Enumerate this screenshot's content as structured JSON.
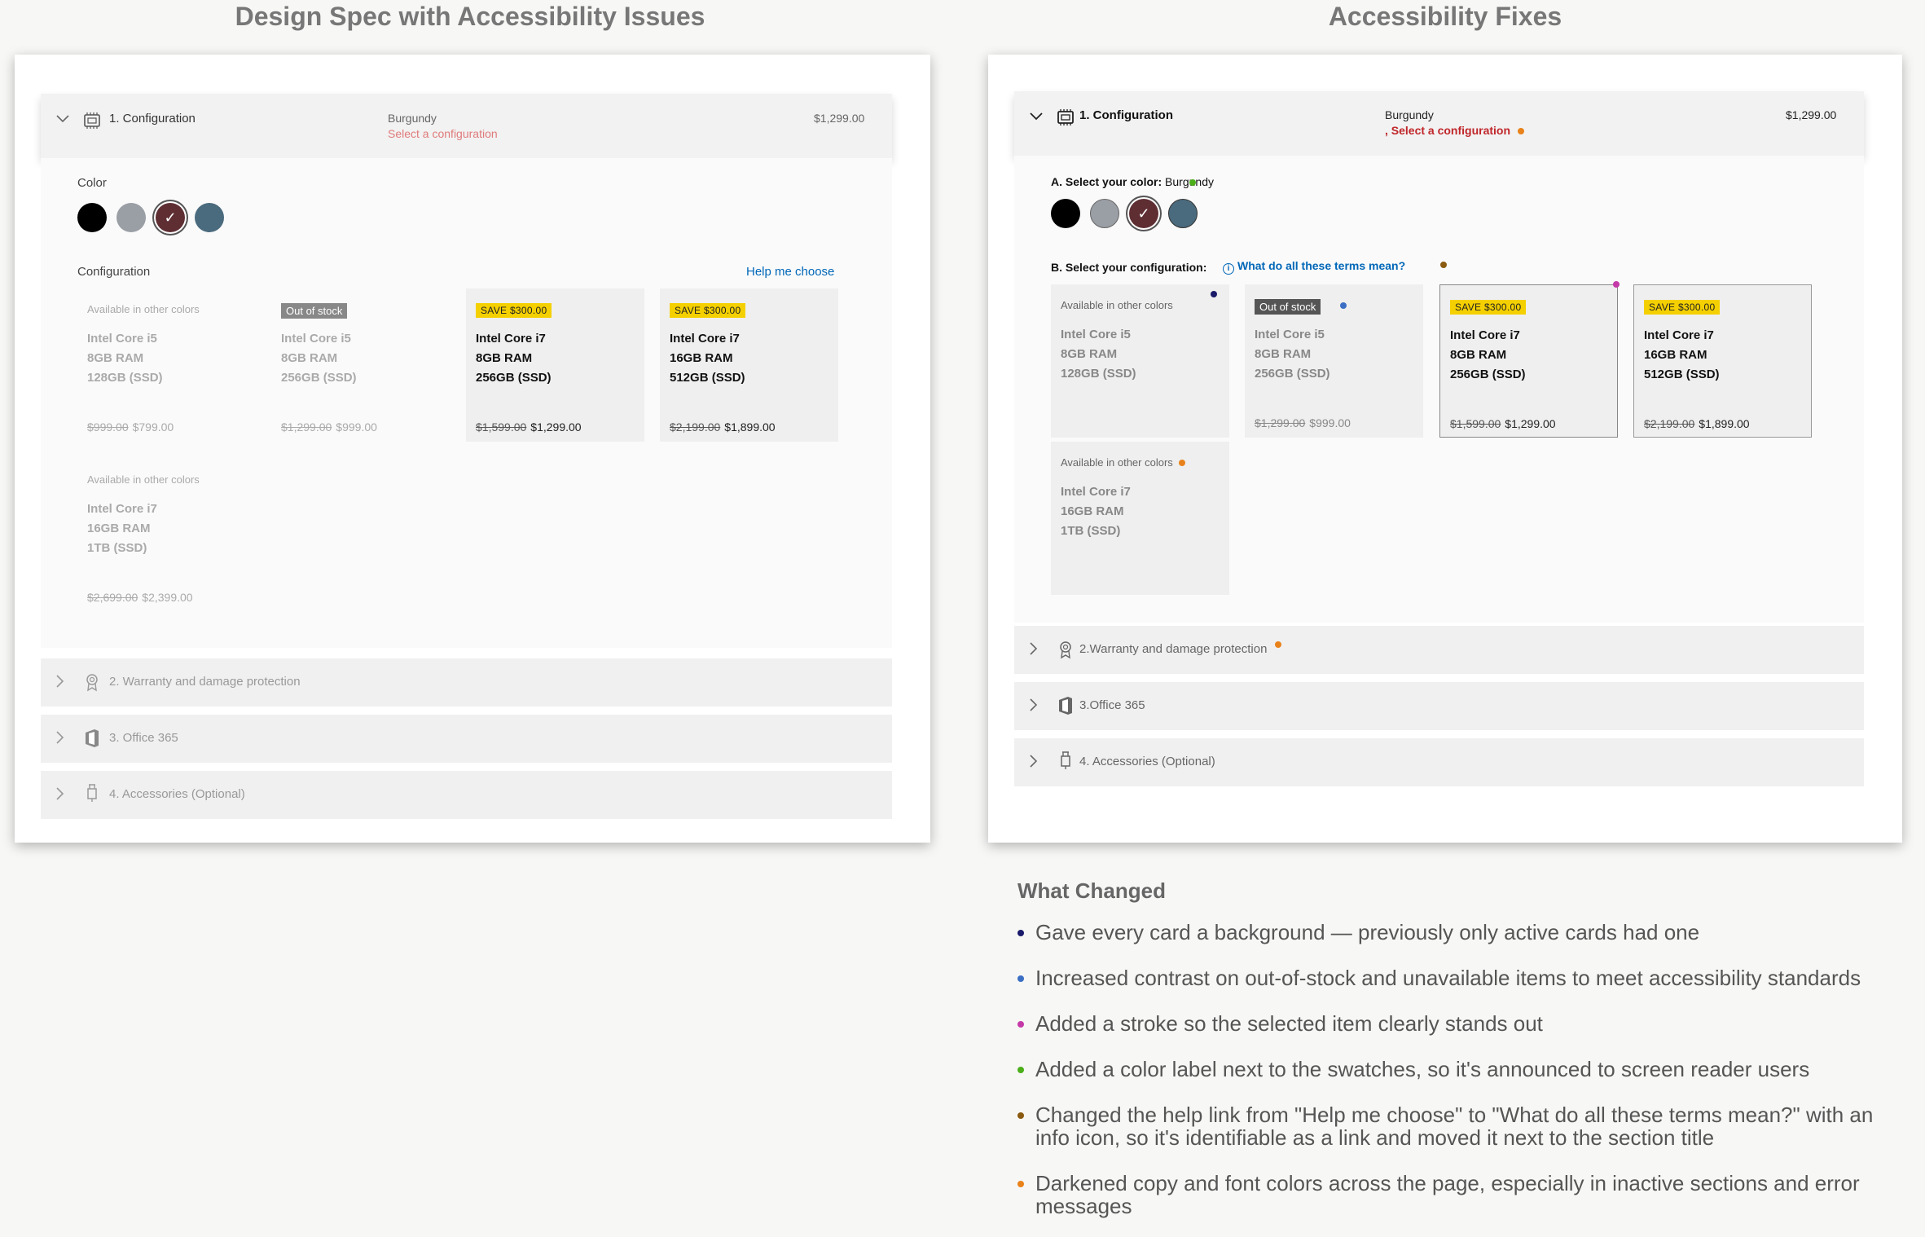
{
  "left_title": "Design Spec with Accessibility Issues",
  "right_title": "Accessibility Fixes",
  "colors": {
    "navy": "#1a1a6b",
    "blue": "#3a6fc4",
    "magenta": "#c43aa8",
    "green": "#4caf1a",
    "brown": "#8a5a10",
    "orange": "#e8821a",
    "sale_yellow": "#f5d000",
    "link_blue": "#0067b8",
    "swatch_black": "#000000",
    "swatch_gray": "#9a9ea5",
    "swatch_burgundy": "#5e2e33",
    "swatch_teal": "#4a6a7d"
  },
  "left": {
    "config_title": "1. Configuration",
    "color_name": "Burgundy",
    "error": "Select a configuration",
    "price": "$1,299.00",
    "color_label": "Color",
    "config_label": "Configuration",
    "help_link": "Help me choose",
    "cards": [
      {
        "tag": "Available in other colors",
        "line1": "Intel Core i5",
        "line2": "8GB RAM",
        "line3": "128GB (SSD)",
        "old": "$999.00",
        "new": "$799.00"
      },
      {
        "tag": "Out of stock",
        "line1": "Intel Core i5",
        "line2": "8GB RAM",
        "line3": "256GB (SSD)",
        "old": "$1,299.00",
        "new": "$999.00"
      },
      {
        "tag": "SAVE $300.00",
        "line1": "Intel Core i7",
        "line2": "8GB RAM",
        "line3": "256GB (SSD)",
        "old": "$1,599.00",
        "new": "$1,299.00"
      },
      {
        "tag": "SAVE $300.00",
        "line1": "Intel Core i7",
        "line2": "16GB RAM",
        "line3": "512GB (SSD)",
        "old": "$2,199.00",
        "new": "$1,899.00"
      },
      {
        "tag": "Available in other colors",
        "line1": "Intel Core i7",
        "line2": "16GB RAM",
        "line3": "1TB (SSD)",
        "old": "$2,699.00",
        "new": "$2,399.00"
      }
    ],
    "warranty": "2. Warranty and damage protection",
    "office": "3. Office 365",
    "accessories": "4. Accessories (Optional)"
  },
  "right": {
    "config_title": "1. Configuration",
    "color_name": "Burgundy",
    "error_prefix": ",",
    "error": "Select a configuration",
    "price": "$1,299.00",
    "color_label": "A. Select your color:",
    "color_value": "Burgundy",
    "config_label": "B. Select your configuration:",
    "help_link": "What do all these terms mean?",
    "cards": [
      {
        "tag": "Available in other colors",
        "line1": "Intel Core i5",
        "line2": "8GB RAM",
        "line3": "128GB (SSD)",
        "old": "",
        "new": ""
      },
      {
        "tag": "Out of stock",
        "line1": "Intel Core i5",
        "line2": "8GB RAM",
        "line3": "256GB (SSD)",
        "old": "$1,299.00",
        "new": "$999.00"
      },
      {
        "tag": "SAVE $300.00",
        "line1": "Intel Core i7",
        "line2": "8GB RAM",
        "line3": "256GB (SSD)",
        "old": "$1,599.00",
        "new": "$1,299.00"
      },
      {
        "tag": "SAVE $300.00",
        "line1": "Intel Core i7",
        "line2": "16GB RAM",
        "line3": "512GB (SSD)",
        "old": "$2,199.00",
        "new": "$1,899.00"
      },
      {
        "tag": "Available in other colors",
        "line1": "Intel Core i7",
        "line2": "16GB RAM",
        "line3": "1TB (SSD)",
        "old": "",
        "new": ""
      }
    ],
    "warranty": "2.Warranty and damage protection",
    "office": "3.Office 365",
    "accessories": "4. Accessories (Optional)"
  },
  "changes_title": "What Changed",
  "changes": [
    "Gave every card a background — previously only active cards had one",
    "Increased contrast on out-of-stock and unavailable items to meet accessibility standards",
    "Added a stroke so the selected item clearly stands out",
    "Added a color label next to the swatches, so it's announced to screen reader users",
    "Changed the help link from \"Help me choose\" to \"What do all these terms mean?\" with an info icon, so it's identifiable as a link and moved it next to the section title",
    "Darkened copy and font colors across the page, especially in inactive sections and error messages"
  ]
}
